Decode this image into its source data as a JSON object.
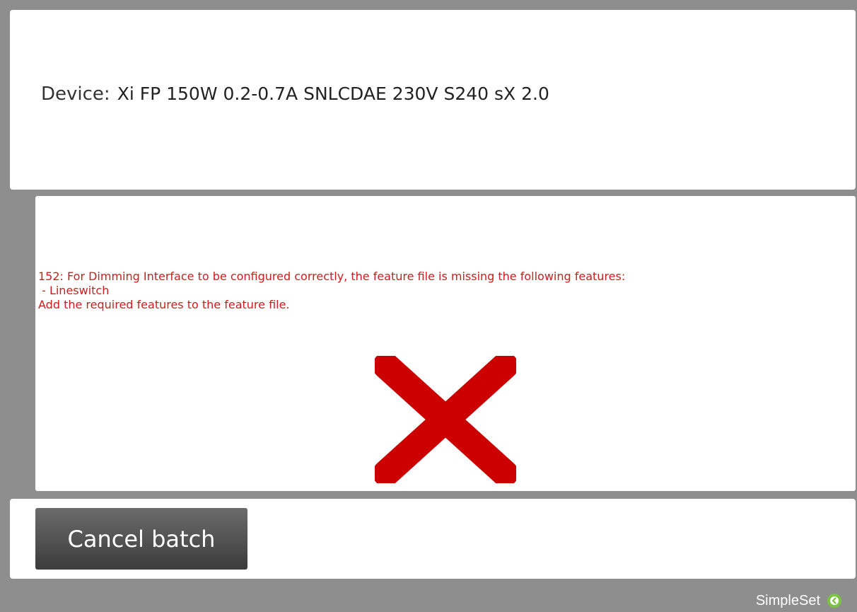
{
  "device": {
    "label": "Device:",
    "name": "Xi FP 150W 0.2-0.7A SNLCDAE 230V S240 sX 2.0"
  },
  "error": {
    "line1": "152: For Dimming Interface to be configured correctly, the feature file is missing the following features:",
    "line2": " - Lineswitch",
    "line3": "Add the required features to the feature file.",
    "color": "#d01c1c",
    "status_icon": "x-icon"
  },
  "actions": {
    "cancel_label": "Cancel batch"
  },
  "footer": {
    "brand": "SimpleSet",
    "brand_icon": "green-circle-arrow-icon",
    "brand_icon_color": "#7cc243"
  }
}
